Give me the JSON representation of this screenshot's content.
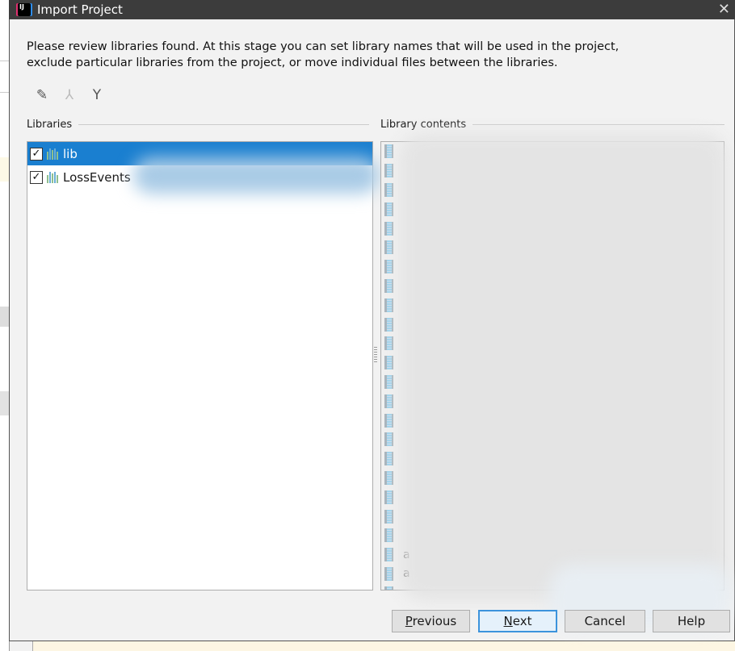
{
  "dialog": {
    "title": "Import Project",
    "description_line1": "Please review libraries found. At this stage you can set library names that will be used in the project,",
    "description_line2": "exclude particular libraries from the project, or move individual files between the libraries."
  },
  "toolbar": {
    "icons": [
      "edit-icon",
      "merge-icon",
      "split-icon"
    ]
  },
  "libraries": {
    "label": "Libraries",
    "items": [
      {
        "name": "lib",
        "checked": true,
        "selected": true
      },
      {
        "name": "LossEvents",
        "checked": true,
        "selected": false
      }
    ]
  },
  "contents": {
    "label": "Library contents",
    "visible_fragments": [
      "a",
      "a"
    ]
  },
  "buttons": {
    "previous_mn": "P",
    "previous_rest": "revious",
    "next_mn": "N",
    "next_rest": "ext",
    "cancel": "Cancel",
    "help": "Help"
  },
  "colors": {
    "selection": "#1a7fd0",
    "titlebar": "#3c3c3c",
    "default_button_border": "#3c93dc"
  }
}
